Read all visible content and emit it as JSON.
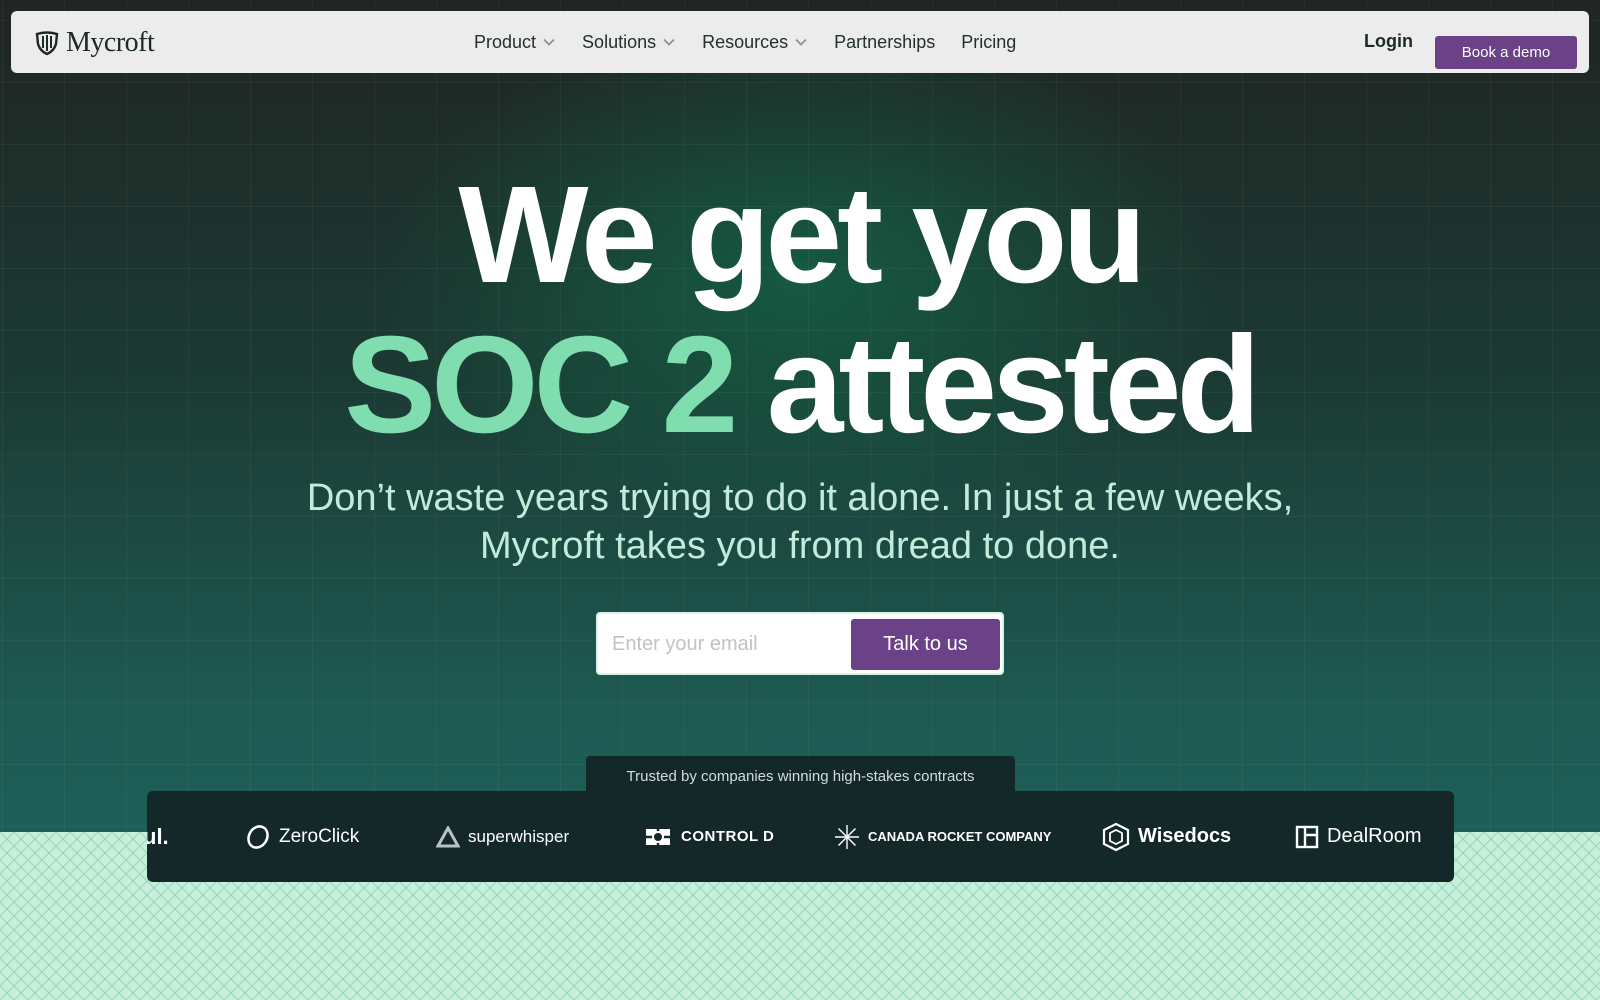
{
  "brand": {
    "name": "Mycroft"
  },
  "nav": {
    "items": [
      {
        "label": "Product",
        "dropdown": true
      },
      {
        "label": "Solutions",
        "dropdown": true
      },
      {
        "label": "Resources",
        "dropdown": true
      },
      {
        "label": "Partnerships",
        "dropdown": false
      },
      {
        "label": "Pricing",
        "dropdown": false
      }
    ],
    "login_label": "Login",
    "demo_label": "Book a demo"
  },
  "hero": {
    "line1": "We get you",
    "line2_accent": "SOC 2",
    "line2_rest": "attested",
    "subhead_1": "Don’t waste years trying to do it alone. In just a few weeks,",
    "subhead_2": "Mycroft takes you from dread to done.",
    "email_placeholder": "Enter your email",
    "cta_label": "Talk to us"
  },
  "trusted": {
    "tagline": "Trusted by companies winning high-stakes contracts",
    "logos": [
      {
        "name": "ul.",
        "icon": ""
      },
      {
        "name": "ZeroClick",
        "icon": "zeroclick-icon"
      },
      {
        "name": "superwhisper",
        "icon": "triangle-icon"
      },
      {
        "name": "CONTROL D",
        "icon": "controld-icon"
      },
      {
        "name": "CANADA ROCKET COMPANY",
        "icon": "starburst-icon"
      },
      {
        "name": "Wisedocs",
        "icon": "cube-icon"
      },
      {
        "name": "DealRoom",
        "icon": "dealroom-icon"
      }
    ]
  },
  "colors": {
    "accent_green": "#7fddb0",
    "button_purple": "#6b4287",
    "nav_bg": "#ececec",
    "dark_bg": "#1f2423",
    "logo_bar_bg": "#14282a",
    "lower_bg": "#c6f0dc"
  }
}
